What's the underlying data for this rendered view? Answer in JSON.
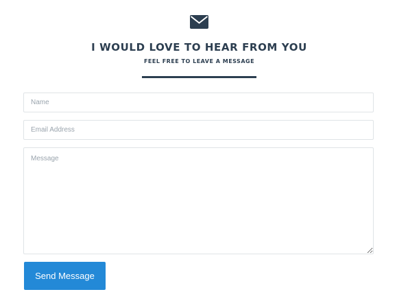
{
  "header": {
    "icon": "envelope-icon",
    "title": "I WOULD LOVE TO HEAR FROM YOU",
    "subtitle": "FEEL FREE TO LEAVE A MESSAGE"
  },
  "form": {
    "name_placeholder": "Name",
    "email_placeholder": "Email Address",
    "message_placeholder": "Message",
    "submit_label": "Send Message"
  },
  "colors": {
    "heading": "#2c3e50",
    "button": "#2389d7",
    "border": "#dfe3e6"
  }
}
